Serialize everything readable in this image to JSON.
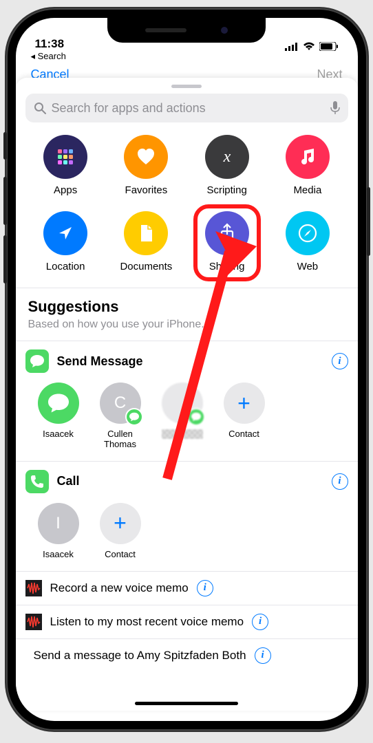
{
  "status": {
    "time": "11:38",
    "back": "Search"
  },
  "underlay": {
    "cancel": "Cancel",
    "next": "Next"
  },
  "search": {
    "placeholder": "Search for apps and actions"
  },
  "categories": [
    {
      "label": "Apps",
      "color": "#2b2660",
      "icon": "apps"
    },
    {
      "label": "Favorites",
      "color": "#ff9500",
      "icon": "heart"
    },
    {
      "label": "Scripting",
      "color": "#3a3a3c",
      "icon": "fx"
    },
    {
      "label": "Media",
      "color": "#ff2d55",
      "icon": "music"
    },
    {
      "label": "Location",
      "color": "#007aff",
      "icon": "navigate"
    },
    {
      "label": "Documents",
      "color": "#ffcc00",
      "icon": "doc"
    },
    {
      "label": "Sharing",
      "color": "#5856d6",
      "icon": "share",
      "highlighted": true
    },
    {
      "label": "Web",
      "color": "#00c7f2",
      "icon": "compass"
    }
  ],
  "suggestions": {
    "title": "Suggestions",
    "subtitle": "Based on how you use your iPhone."
  },
  "send_message": {
    "title": "Send Message",
    "contacts": [
      {
        "name": "Isaacek",
        "type": "app-icon"
      },
      {
        "name": "Cullen Thomas",
        "type": "initial",
        "initial": "C"
      },
      {
        "name": "",
        "type": "blurred"
      },
      {
        "name": "Contact",
        "type": "add"
      }
    ]
  },
  "call": {
    "title": "Call",
    "contacts": [
      {
        "name": "Isaacek",
        "type": "initial",
        "initial": "I"
      },
      {
        "name": "Contact",
        "type": "add"
      }
    ]
  },
  "simple_suggestions": [
    {
      "label": "Record a new voice memo",
      "icon": "voicememo"
    },
    {
      "label": "Listen to my most recent voice memo",
      "icon": "voicememo"
    },
    {
      "label": "Send a message to Amy Spitzfaden Both",
      "icon": "pink"
    }
  ]
}
